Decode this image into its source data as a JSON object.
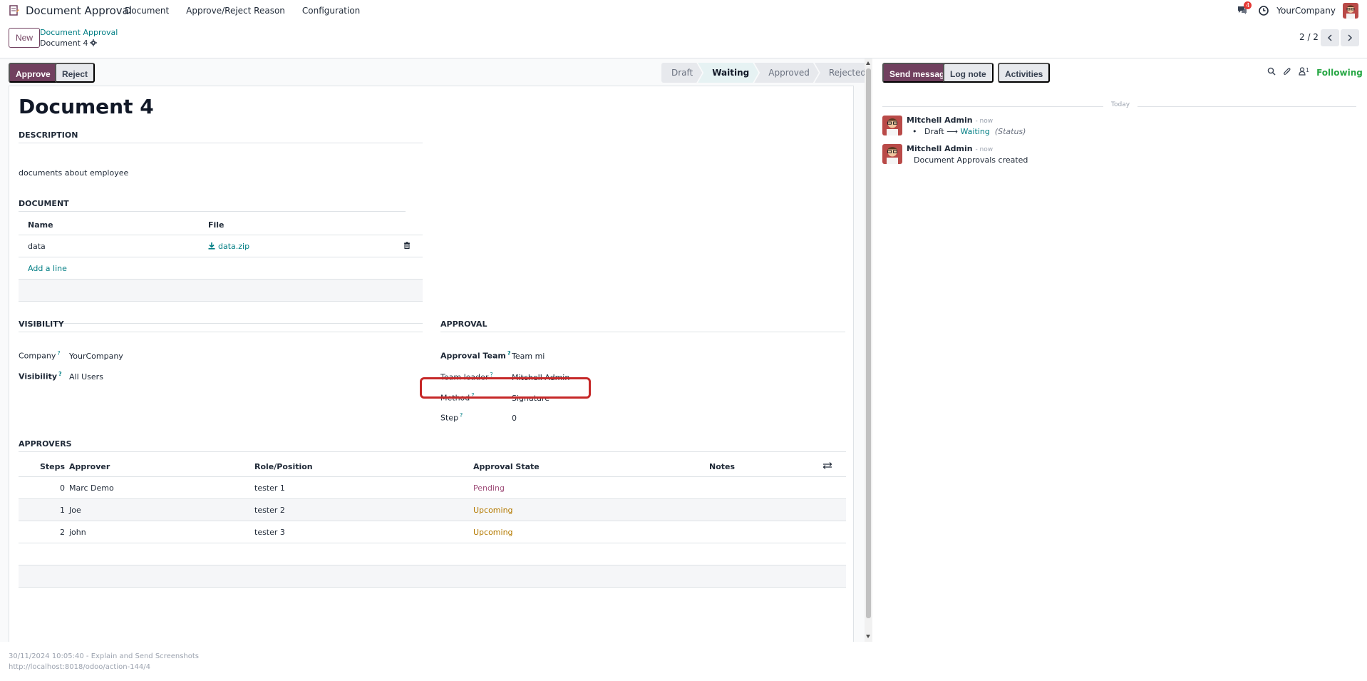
{
  "navbar": {
    "app_name": "Document Approval",
    "menu": [
      "Document",
      "Approve/Reject Reason",
      "Configuration"
    ],
    "chat_badge": "4",
    "company": "YourCompany"
  },
  "control_panel": {
    "new_label": "New",
    "breadcrumb_parent": "Document Approval",
    "breadcrumb_current": "Document 4",
    "pager": "2 / 2"
  },
  "form": {
    "approve_label": "Approve",
    "reject_label": "Reject",
    "stages": [
      "Draft",
      "Waiting",
      "Approved",
      "Rejected"
    ],
    "active_stage": "Waiting",
    "title": "Document 4",
    "description_title": "DESCRIPTION",
    "description": "documents about employee",
    "document_title": "DOCUMENT",
    "document_table": {
      "headers": [
        "Name",
        "File"
      ],
      "rows": [
        {
          "name": "data",
          "file": "data.zip"
        }
      ],
      "add_line": "Add a line"
    },
    "visibility_title": "VISIBILITY",
    "company_label": "Company",
    "company_value": "YourCompany",
    "visibility_label": "Visibility",
    "visibility_value": "All Users",
    "approval_title": "APPROVAL",
    "approval_team_label": "Approval Team",
    "approval_team_value": "Team mi",
    "team_leader_label": "Team leader",
    "team_leader_value": "Mitchell Admin",
    "method_label": "Method",
    "method_value": "Signature",
    "step_label": "Step",
    "step_value": "0",
    "approvers_title": "APPROVERS",
    "approvers_table": {
      "headers": [
        "Steps",
        "Approver",
        "Role/Position",
        "Approval State",
        "Notes"
      ],
      "rows": [
        {
          "step": "0",
          "approver": "Marc Demo",
          "role": "tester 1",
          "state": "Pending"
        },
        {
          "step": "1",
          "approver": "Joe",
          "role": "tester 2",
          "state": "Upcoming"
        },
        {
          "step": "2",
          "approver": "john",
          "role": "tester 3",
          "state": "Upcoming"
        }
      ]
    }
  },
  "chatter": {
    "send_message": "Send message",
    "log_note": "Log note",
    "activities": "Activities",
    "followers_count": "1",
    "following": "Following",
    "date_separator": "Today",
    "messages": [
      {
        "author": "Mitchell Admin",
        "time": "- now",
        "from": "Draft",
        "to": "Waiting",
        "field": "(Status)"
      },
      {
        "author": "Mitchell Admin",
        "time": "- now",
        "body": "Document Approvals created"
      }
    ]
  },
  "footer": {
    "line1": "30/11/2024 10:05:40 - Explain and Send Screenshots",
    "line2": "http://localhost:8018/odoo/action-144/4"
  },
  "colors": {
    "brand": "#71405f",
    "link": "#017e84",
    "highlight": "#c62828",
    "pending": "#a0507b",
    "upcoming": "#b47a00",
    "following": "#28a745"
  }
}
